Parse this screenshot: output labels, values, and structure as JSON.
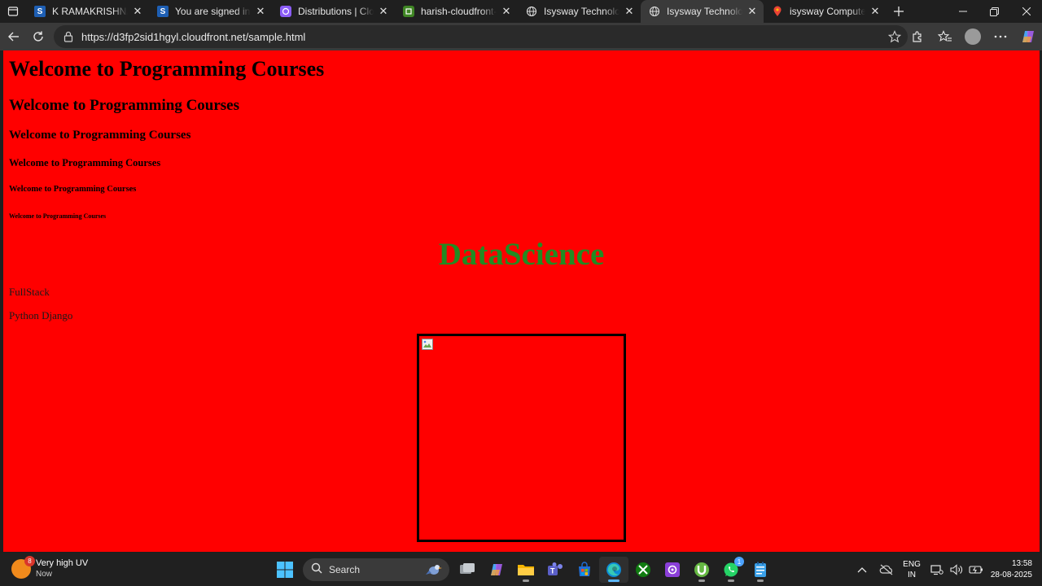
{
  "browser": {
    "tabs": [
      {
        "title": "K RAMAKRISHNAN GR",
        "favicon": "s-icon",
        "color": "#1e5fb4",
        "active": false
      },
      {
        "title": "You are signed in as st",
        "favicon": "s-icon",
        "color": "#1e5fb4",
        "active": false
      },
      {
        "title": "Distributions | CloudFr",
        "favicon": "cloudfront-icon",
        "color": "#8b5cf6",
        "active": false
      },
      {
        "title": "harish-cloudfront-buck",
        "favicon": "s3-icon",
        "color": "#3f8624",
        "active": false
      },
      {
        "title": "Isysway Technologies",
        "favicon": "globe-icon",
        "color": "#cccccc",
        "active": false
      },
      {
        "title": "Isysway Technologies",
        "favicon": "globe-icon",
        "color": "#cccccc",
        "active": true
      },
      {
        "title": "isysway Computer Edu",
        "favicon": "maps-pin-icon",
        "color": "#ea4335",
        "active": false
      }
    ],
    "url": "https://d3fp2sid1hgyl.cloudfront.net/sample.html"
  },
  "page": {
    "background": "#ff0000",
    "h1": "Welcome to Programming Courses",
    "h2": "Welcome to Programming Courses",
    "h3": "Welcome to Programming Courses",
    "h4": "Welcome to Programming Courses",
    "h5": "Welcome to Programming Courses",
    "h6": "Welcome to Programming Courses",
    "datascience": "DataScience",
    "datascience_color": "#228b22",
    "link1": "FullStack",
    "link2": "Python Django"
  },
  "taskbar": {
    "weather": {
      "badge": "8",
      "title": "Very high UV",
      "subtitle": "Now"
    },
    "search_label": "Search",
    "whatsapp_badge": "1",
    "lang_top": "ENG",
    "lang_bottom": "IN",
    "time": "13:58",
    "date": "28-08-2025"
  }
}
